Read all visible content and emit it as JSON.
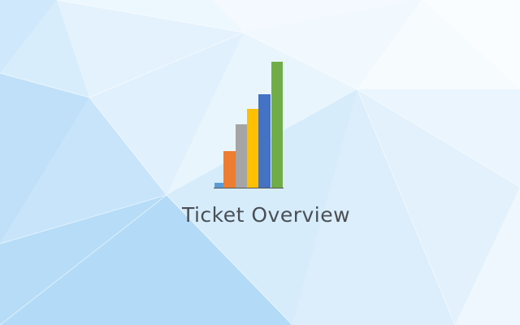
{
  "app": {
    "title": "Ticket Overview",
    "icon": "bar-chart-icon"
  },
  "colors": {
    "background": "#e6f3fd",
    "title_text": "#4a4f55",
    "bars": [
      "#5b9bd5",
      "#ed7d31",
      "#a5a5a5",
      "#ffc000",
      "#4472c4",
      "#70ad47"
    ],
    "axis": "#595959"
  }
}
